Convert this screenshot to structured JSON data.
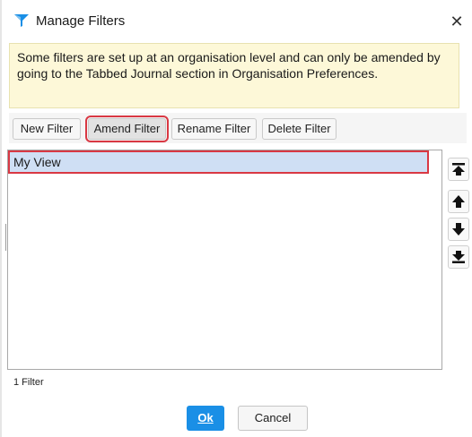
{
  "dialog": {
    "title": "Manage Filters",
    "title_icon": "funnel-icon",
    "close_glyph": "✕"
  },
  "banner": {
    "text": "Some filters are set up at an organisation level and can only be amended by going to the Tabbed Journal section in Organisation Preferences."
  },
  "toolbar": {
    "new_filter": "New Filter",
    "amend_filter": "Amend Filter",
    "rename_filter": "Rename Filter",
    "delete_filter": "Delete Filter"
  },
  "filters": {
    "items": [
      {
        "label": "My View",
        "selected": true
      }
    ],
    "count_label": "1 Filter"
  },
  "move_buttons": [
    "move-to-top-icon",
    "move-up-icon",
    "move-down-icon",
    "move-to-bottom-icon"
  ],
  "footer": {
    "ok_label": "Ok",
    "cancel_label": "Cancel"
  },
  "colors": {
    "accent": "#1a8fe6",
    "banner_bg": "#fdf8d8",
    "selection_bg": "#cfdff4",
    "highlight_outline": "#d93843"
  }
}
